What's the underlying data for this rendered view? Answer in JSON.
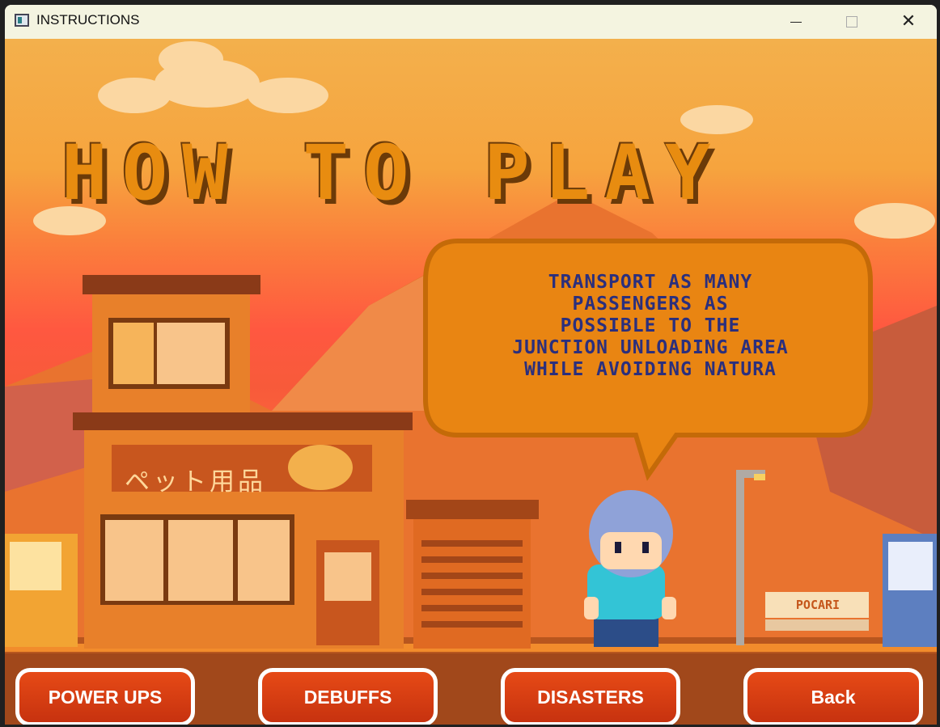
{
  "window": {
    "title": "INSTRUCTIONS"
  },
  "screen": {
    "heading": "HOW TO PLAY",
    "instructions": [
      "TRANSPORT AS MANY",
      "PASSENGERS AS",
      "POSSIBLE TO THE",
      "JUNCTION UNLOADING AREA",
      "WHILE AVOIDING NATURA"
    ],
    "shop_sign": "ペット用品",
    "bench_sign": "POCARI"
  },
  "buttons": {
    "power_ups": "POWER UPS",
    "debuffs": "DEBUFFS",
    "disasters": "DISASTERS",
    "back": "Back"
  },
  "colors": {
    "button": "#d63e12",
    "title": "#e88c10",
    "bubble_text": "#2b2f7d"
  }
}
